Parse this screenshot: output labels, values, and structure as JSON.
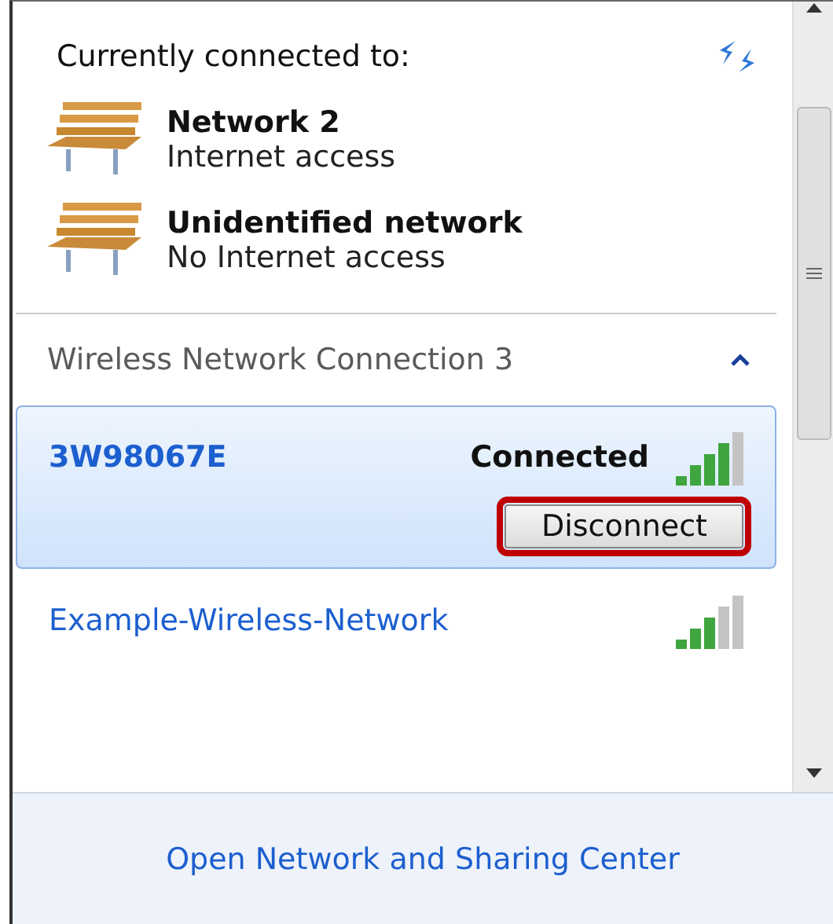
{
  "header": {
    "title": "Currently connected to:"
  },
  "connections": [
    {
      "name": "Network 2",
      "status": "Internet access"
    },
    {
      "name": "Unidentified network",
      "status": "No Internet access"
    }
  ],
  "section": {
    "title": "Wireless Network Connection 3",
    "expanded": true
  },
  "networks": [
    {
      "name": "3W98067E",
      "selected": true,
      "status": "Connected",
      "kind": "strong",
      "button": {
        "label": "Disconnect",
        "highlighted": true
      }
    },
    {
      "name": "Example-Wireless-Network",
      "selected": false,
      "kind": "medium"
    }
  ],
  "footer": {
    "link": "Open Network and Sharing Center"
  }
}
